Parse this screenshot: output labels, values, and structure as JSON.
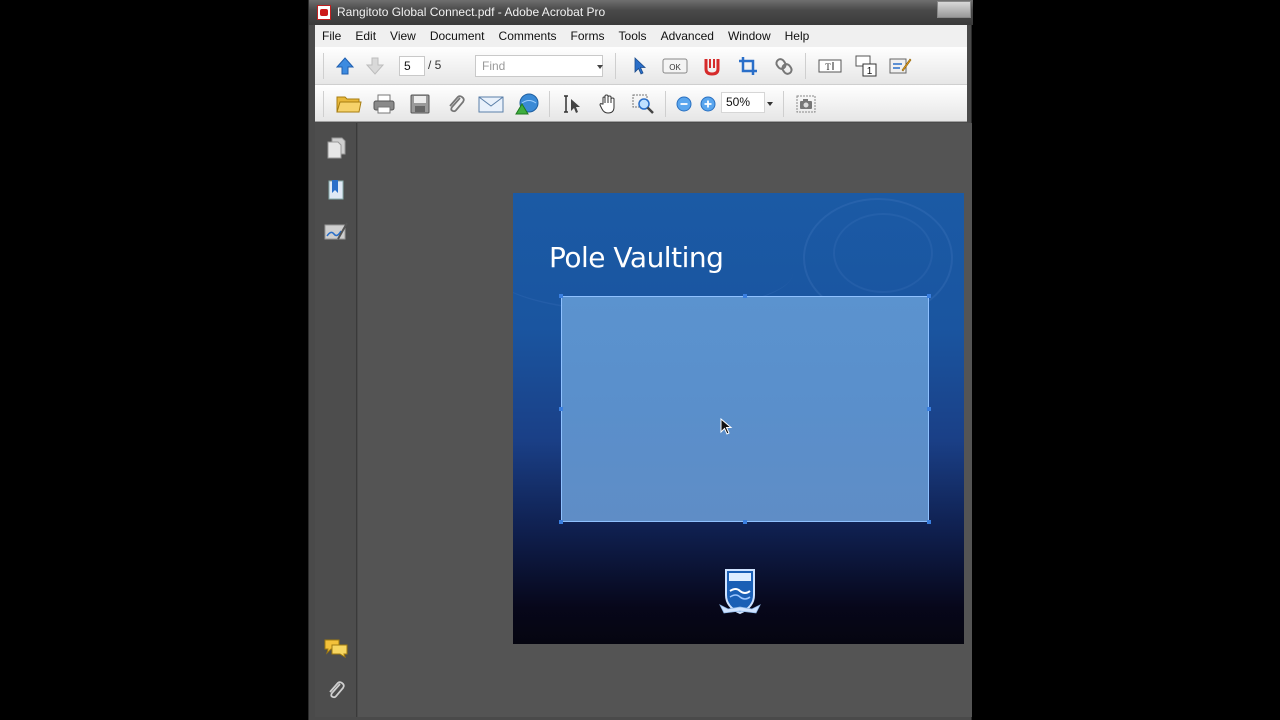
{
  "window": {
    "title": "Rangitoto Global Connect.pdf - Adobe Acrobat Pro"
  },
  "menu": [
    "File",
    "Edit",
    "View",
    "Document",
    "Comments",
    "Forms",
    "Tools",
    "Advanced",
    "Window",
    "Help"
  ],
  "toolbar1": {
    "current_page": "5",
    "total_pages": "/ 5",
    "find_placeholder": "Find"
  },
  "toolbar2": {
    "zoom": "50%"
  },
  "page": {
    "slide_title": "Pole Vaulting"
  },
  "icons": {
    "nav": [
      "pages-icon",
      "bookmarks-icon",
      "signatures-icon",
      "comments-icon",
      "attachments-icon"
    ]
  },
  "colors": {
    "slide_top": "#1b5aa5",
    "slide_bottom": "#050510",
    "media_box": "#5b93cf",
    "media_border": "#8fc1ff"
  }
}
